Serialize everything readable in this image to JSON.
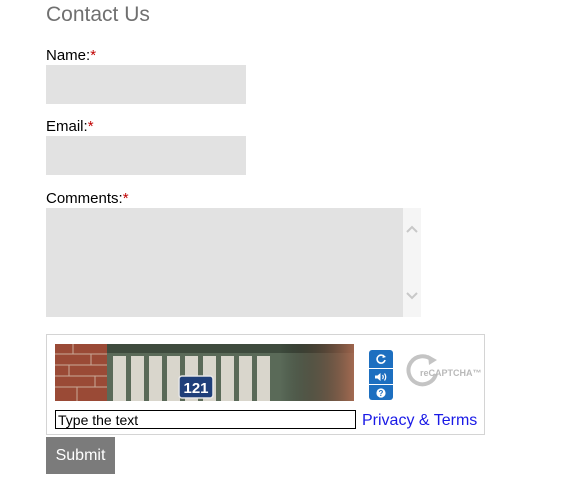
{
  "form": {
    "title": "Contact Us",
    "required_mark": "*",
    "name": {
      "label": "Name:",
      "value": ""
    },
    "email": {
      "label": "Email:",
      "value": ""
    },
    "comments": {
      "label": "Comments:",
      "value": ""
    }
  },
  "captcha": {
    "image_text": "121",
    "input_placeholder": "Type the text",
    "privacy_link": "Privacy & Terms",
    "logo_text": "reCAPTCHA™",
    "buttons": [
      "refresh-icon",
      "audio-icon",
      "help-icon"
    ],
    "accent_color": "#1d6fc0"
  },
  "submit_label": "Submit",
  "colors": {
    "title": "#707070",
    "field_bg": "#e2e2e2",
    "required": "#c00000",
    "link": "#1a1ae6",
    "submit_bg": "#7b7b7b"
  }
}
